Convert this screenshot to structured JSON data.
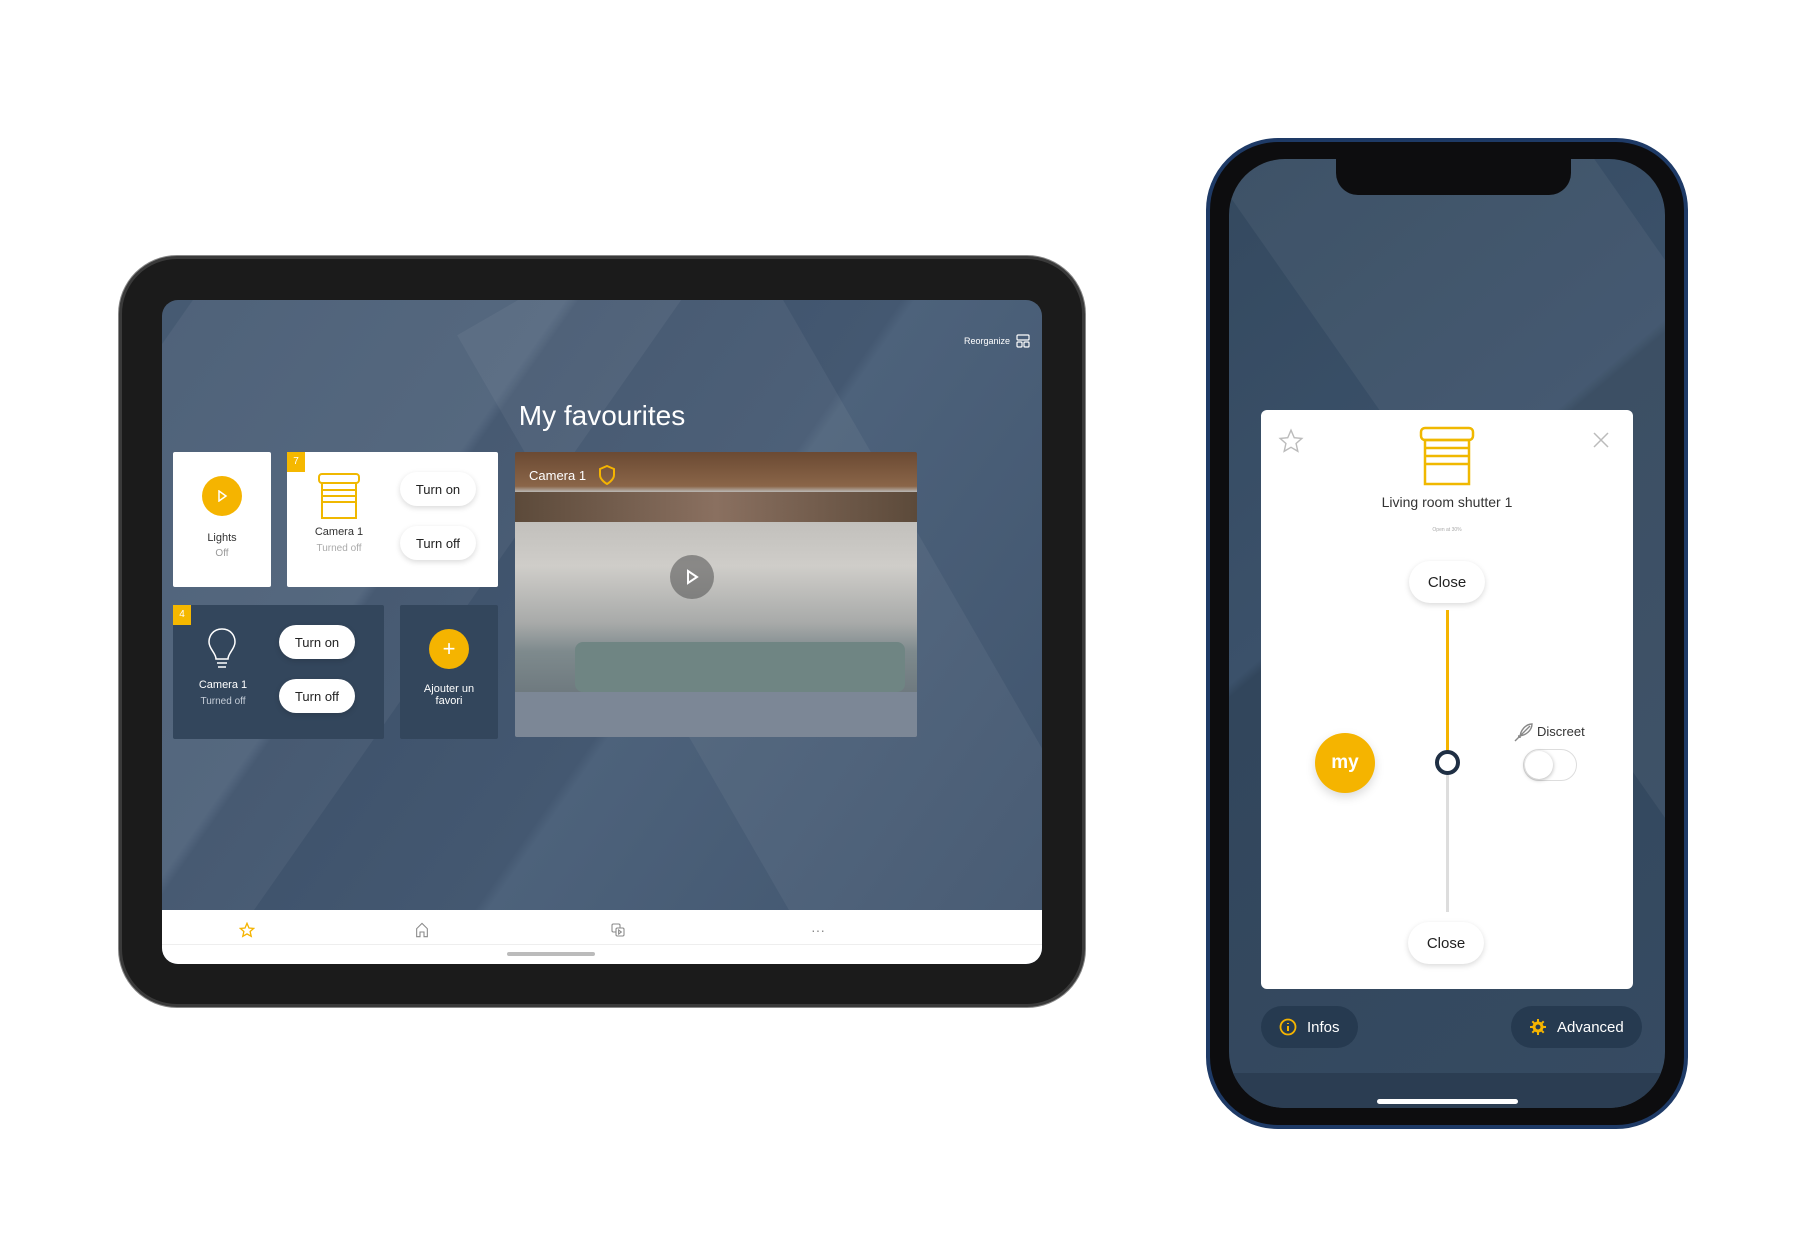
{
  "tablet": {
    "reorganize_label": "Reorganize",
    "title": "My favourites",
    "lights_card": {
      "name": "Lights",
      "status": "Off",
      "icon": "play-icon"
    },
    "shutter_card": {
      "badge": "7",
      "name": "Camera 1",
      "status": "Turned off",
      "turn_on": "Turn on",
      "turn_off": "Turn off"
    },
    "bulb_card": {
      "badge": "4",
      "name": "Camera 1",
      "status": "Turned off",
      "turn_on": "Turn on",
      "turn_off": "Turn off"
    },
    "add_card": {
      "label": "Ajouter un favori"
    },
    "camera_card": {
      "name": "Camera 1"
    },
    "tabs": [
      "favourites-star-icon",
      "home-icon",
      "scenarios-icon",
      "more-icon"
    ],
    "accent": "#f5b400"
  },
  "phone": {
    "device_name": "Living room shutter 1",
    "status": "Open at 30%",
    "open_percent": 30,
    "close_top": "Close",
    "close_bottom": "Close",
    "my_label": "my",
    "discreet_label": "Discreet",
    "discreet_on": false,
    "infos_label": "Infos",
    "advanced_label": "Advanced"
  }
}
